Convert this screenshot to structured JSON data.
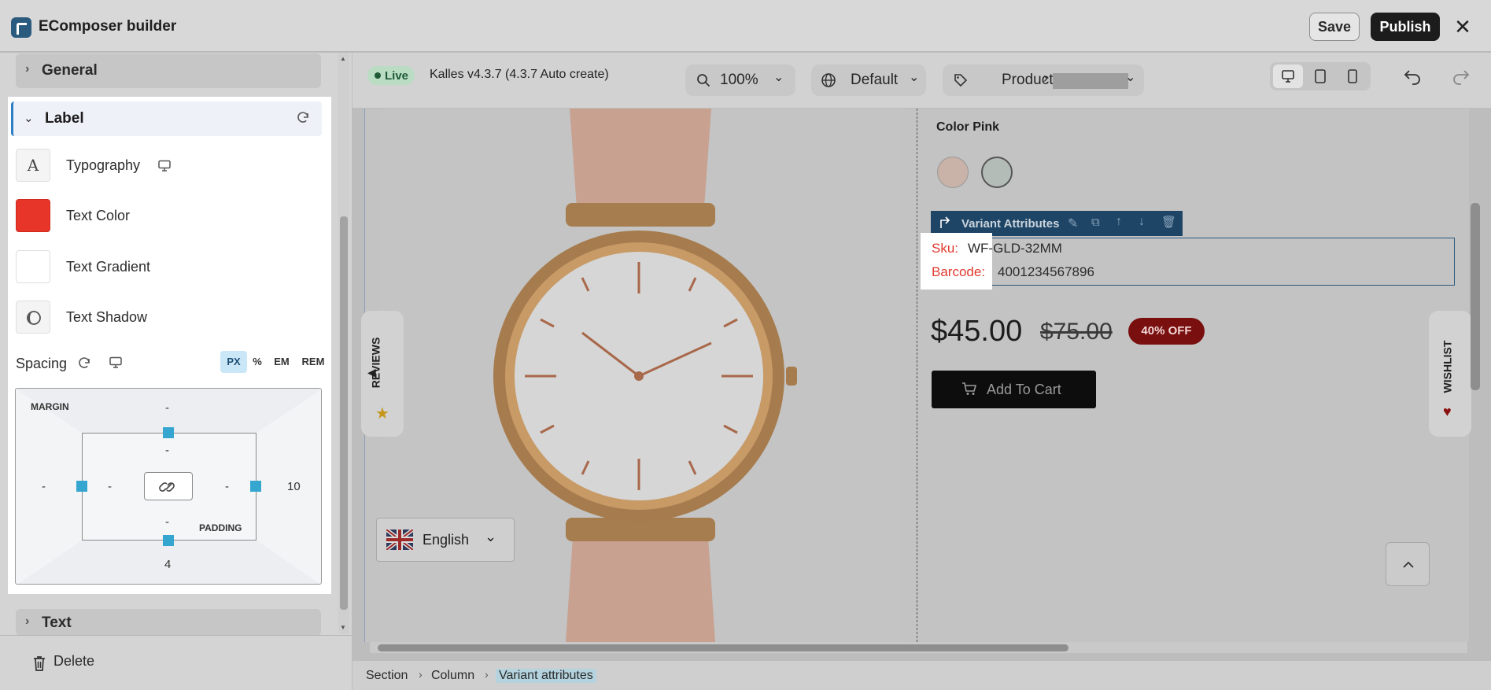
{
  "app": {
    "title": "EComposer builder"
  },
  "topbar": {
    "save_label": "Save",
    "publish_label": "Publish",
    "close_glyph": "✕"
  },
  "sidebar": {
    "general_label": "General",
    "label_section": {
      "title": "Label",
      "properties": [
        {
          "label": "Typography",
          "icon": "typography-icon"
        },
        {
          "label": "Text Color",
          "color": "#e8352a"
        },
        {
          "label": "Text Gradient"
        },
        {
          "label": "Text Shadow",
          "icon": "shadow-icon"
        }
      ],
      "spacing": {
        "label": "Spacing",
        "units": [
          "PX",
          "%",
          "EM",
          "REM"
        ],
        "active_unit": "PX",
        "margin_label": "MARGIN",
        "padding_label": "PADDING",
        "margin": {
          "top": "-",
          "right": "10",
          "bottom": "4",
          "left": "-"
        },
        "padding": {
          "top": "-",
          "right": "-",
          "bottom": "-",
          "left": "-"
        }
      }
    },
    "text_label": "Text",
    "delete_label": "Delete"
  },
  "canvas_toolbar": {
    "live_label": "Live",
    "theme_name": "Kalles v4.3.7 (4.3.7 Auto create)",
    "zoom": "100%",
    "language": "Default",
    "page_type": "Products"
  },
  "preview": {
    "color_title": "Color Pink",
    "variant_toolbar_label": "Variant Attributes",
    "sku_label": "Sku:",
    "sku_value": "WF-GLD-32MM",
    "barcode_label": "Barcode:",
    "barcode_value": "4001234567896",
    "price": "$45.00",
    "compare_price": "$75.00",
    "discount_badge": "40% OFF",
    "add_to_cart": "Add To Cart",
    "reviews_tab": "REVIEWS",
    "wishlist_tab": "WISHLIST",
    "language_selector": "English"
  },
  "breadcrumb": [
    "Section",
    "Column",
    "Variant attributes"
  ],
  "colors": {
    "accent": "#35a6cf",
    "primary_dark": "#1c1c1c",
    "label_red": "#e03a2f",
    "selection_blue": "#2a5a7e"
  }
}
